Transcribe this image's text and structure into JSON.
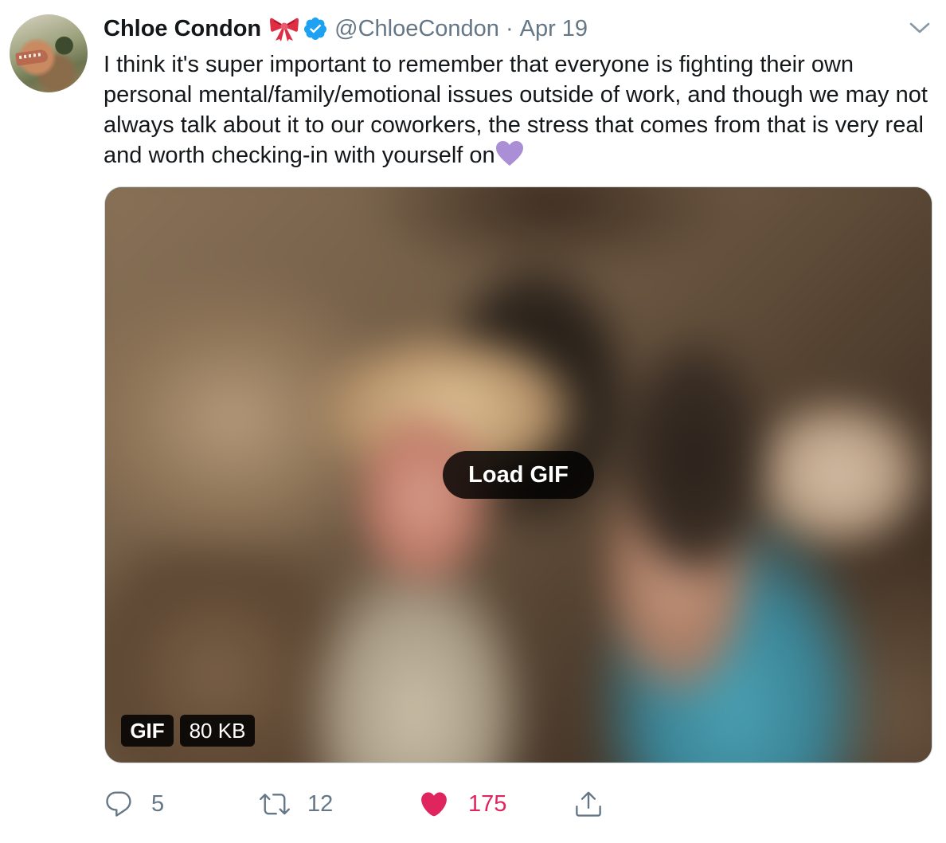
{
  "tweet": {
    "author": {
      "display_name": "Chloe Condon",
      "handle": "@ChloeCondon",
      "separator": "·",
      "date": "Apr 19",
      "badges": [
        "ribbon-bow-icon",
        "verified-badge-icon"
      ]
    },
    "text": "I think it's super important to remember that everyone is fighting their own personal mental/family/emotional issues outside of work, and though we may not always talk about it to our coworkers, the stress that comes from that is very real and worth checking-in with yourself on",
    "trailing_emoji": "purple-heart-icon",
    "media": {
      "load_label": "Load GIF",
      "type_badge": "GIF",
      "size_badge": "80 KB"
    },
    "actions": {
      "replies": "5",
      "retweets": "12",
      "likes": "175"
    },
    "colors": {
      "secondary_text": "#657786",
      "like_red": "#e0245e",
      "verified_blue": "#1da1f2",
      "heart_purple": "#aa8ed6"
    }
  }
}
